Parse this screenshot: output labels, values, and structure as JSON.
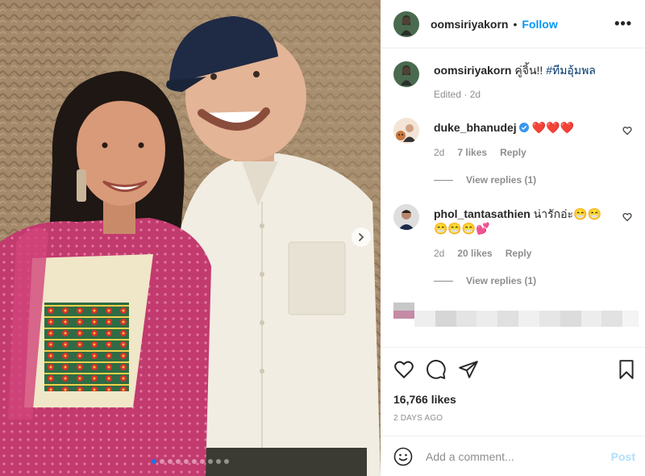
{
  "post": {
    "username": "oomsiriyakorn",
    "bullet": "•",
    "follow_label": "Follow",
    "more_label": "•••"
  },
  "caption": {
    "username": "oomsiriyakorn",
    "text": "คู่จิ้น!!",
    "hashtag": "#ทีมอุ้มพล",
    "edited": "Edited · 2d"
  },
  "comments": [
    {
      "username": "duke_bhanudej",
      "text": "❤️❤️❤️",
      "time": "2d",
      "likes": "7 likes",
      "reply_label": "Reply",
      "view_replies": "View replies (1)"
    },
    {
      "username": "phol_tantasathien",
      "text": "น่ารักอ่ะ😁😁😁😁😁💕",
      "time": "2d",
      "likes": "20 likes",
      "reply_label": "Reply",
      "view_replies": "View replies (1)"
    }
  ],
  "stats": {
    "likes": "16,766 likes",
    "date": "2 DAYS AGO"
  },
  "comment_box": {
    "placeholder": "Add a comment...",
    "post_label": "Post"
  },
  "carousel": {
    "total": 10,
    "current": 1
  },
  "colors": {
    "accent": "#0095f6",
    "verified": "#3897f0",
    "dot_active": "#1a73e8"
  }
}
